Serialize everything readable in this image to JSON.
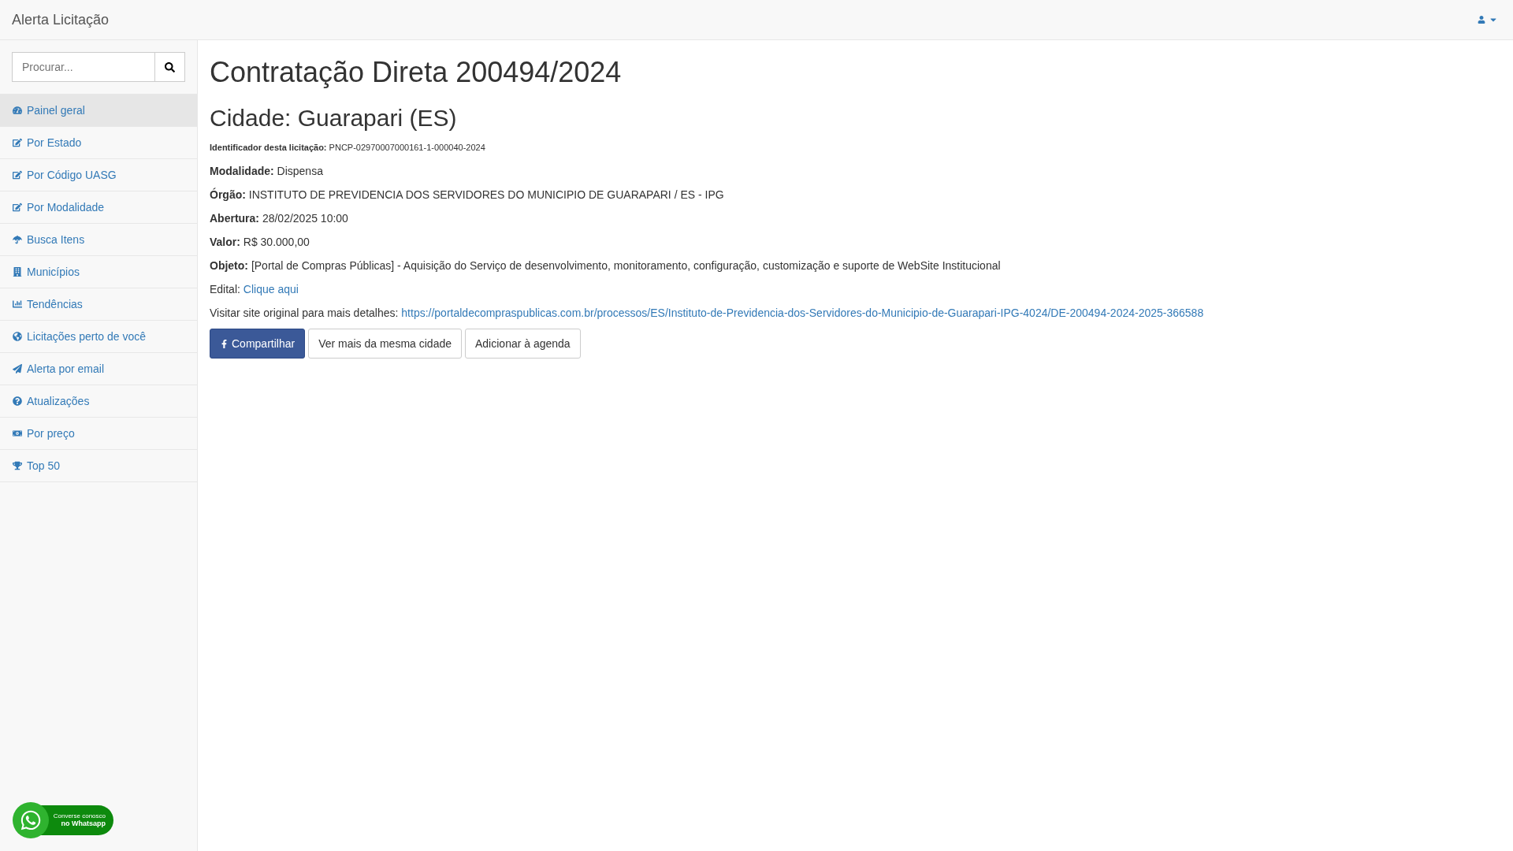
{
  "navbar": {
    "brand": "Alerta Licitação"
  },
  "search": {
    "placeholder": "Procurar..."
  },
  "sidebar": {
    "items": [
      {
        "label": "Painel geral",
        "selected": true
      },
      {
        "label": "Por Estado",
        "selected": false
      },
      {
        "label": "Por Código UASG",
        "selected": false
      },
      {
        "label": "Por Modalidade",
        "selected": false
      },
      {
        "label": "Busca Itens",
        "selected": false
      },
      {
        "label": "Municípios",
        "selected": false
      },
      {
        "label": "Tendências",
        "selected": false
      },
      {
        "label": "Licitações perto de você",
        "selected": false
      },
      {
        "label": "Alerta por email",
        "selected": false
      },
      {
        "label": "Atualizações",
        "selected": false
      },
      {
        "label": "Por preço",
        "selected": false
      },
      {
        "label": "Top 50",
        "selected": false
      }
    ]
  },
  "whatsapp": {
    "line_1": "Converse conosco",
    "line_2": "no Whatsapp"
  },
  "title": "Contratação Direta 200494/2024",
  "subtitle": "Cidade: Guarapari (ES)",
  "details": [
    {
      "kind": "small",
      "label": "Identificador desta licitação:",
      "value": "PNCP-02970007000161-1-000040-2024"
    },
    {
      "kind": "field",
      "label": "Modalidade:",
      "value": "Dispensa"
    },
    {
      "kind": "field",
      "label": "Órgão:",
      "value": "INSTITUTO DE PREVIDENCIA DOS SERVIDORES DO MUNICIPIO DE GUARAPARI / ES - IPG"
    },
    {
      "kind": "field",
      "label": "Abertura:",
      "value": "28/02/2025 10:00"
    },
    {
      "kind": "field",
      "label": "Valor:",
      "value": "R$ 30.000,00"
    },
    {
      "kind": "field",
      "label": "Objeto:",
      "value": "[Portal de Compras Públicas] - Aquisição do Serviço de desenvolvimento, monitoramento, configuração, customização e suporte de WebSite Institucional"
    },
    {
      "kind": "link",
      "label": "Edital:",
      "value": "Clique aqui"
    },
    {
      "kind": "link",
      "label": "Visitar site original para mais detalhes:",
      "value": "https://portaldecompraspublicas.com.br/processos/ES/Instituto-de-Previdencia-dos-Servidores-do-Municipio-de-Guarapari-IPG-4024/DE-200494-2024-2025-366588"
    }
  ],
  "buttons": [
    {
      "kind": "facebook",
      "label": "Compartilhar"
    },
    {
      "kind": "default",
      "label": "Ver mais da mesma cidade"
    },
    {
      "kind": "default",
      "label": "Adicionar à agenda"
    }
  ]
}
